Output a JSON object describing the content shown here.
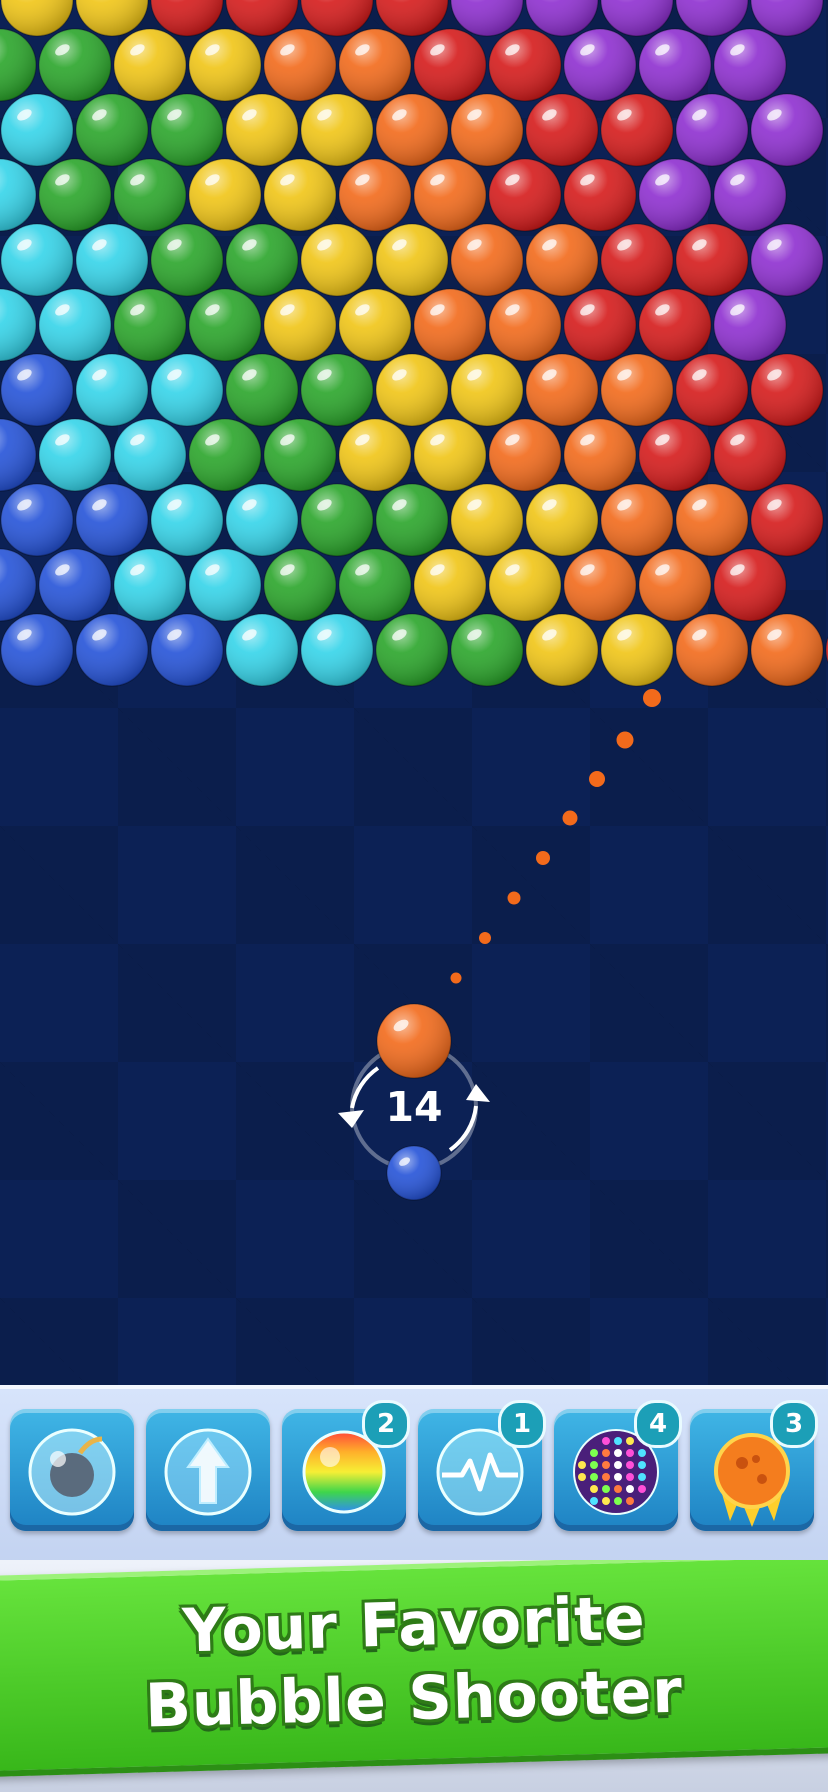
{
  "game": {
    "shots_left": "14",
    "current_bubble": "orange",
    "next_bubble": "blue"
  },
  "bubble_colors": {
    "green": "#2aa52a",
    "yellow": "#f0c516",
    "orange": "#f26a1b",
    "red": "#d51b1b",
    "purple": "#8e2fd0",
    "cyan": "#35d4e9",
    "blue": "#2553d8"
  },
  "bubble_grid": [
    [
      "yellow",
      "yellow",
      "red",
      "red",
      "red",
      "red",
      "purple",
      "purple",
      "purple",
      "purple",
      "purple"
    ],
    [
      "green",
      "green",
      "yellow",
      "yellow",
      "orange",
      "orange",
      "red",
      "red",
      "purple",
      "purple",
      "purple"
    ],
    [
      "cyan",
      "green",
      "green",
      "yellow",
      "yellow",
      "orange",
      "orange",
      "red",
      "red",
      "purple",
      "purple"
    ],
    [
      "cyan",
      "green",
      "green",
      "yellow",
      "yellow",
      "orange",
      "orange",
      "red",
      "red",
      "purple",
      "purple"
    ],
    [
      "cyan",
      "cyan",
      "green",
      "green",
      "yellow",
      "yellow",
      "orange",
      "orange",
      "red",
      "red",
      "purple"
    ],
    [
      "cyan",
      "cyan",
      "green",
      "green",
      "yellow",
      "yellow",
      "orange",
      "orange",
      "red",
      "red",
      "purple"
    ],
    [
      "blue",
      "cyan",
      "cyan",
      "green",
      "green",
      "yellow",
      "yellow",
      "orange",
      "orange",
      "red",
      "red"
    ],
    [
      "blue",
      "cyan",
      "cyan",
      "green",
      "green",
      "yellow",
      "yellow",
      "orange",
      "orange",
      "red",
      "red"
    ],
    [
      "blue",
      "blue",
      "cyan",
      "cyan",
      "green",
      "green",
      "yellow",
      "yellow",
      "orange",
      "orange",
      "red"
    ],
    [
      "blue",
      "blue",
      "cyan",
      "cyan",
      "green",
      "green",
      "yellow",
      "yellow",
      "orange",
      "orange",
      "red"
    ],
    [
      "blue",
      "blue",
      "blue",
      "cyan",
      "cyan",
      "green",
      "green",
      "yellow",
      "yellow",
      "orange",
      "orange",
      "red"
    ]
  ],
  "boosters": [
    {
      "name": "bomb",
      "icon": "bomb-bubble-icon",
      "count": ""
    },
    {
      "name": "arrow",
      "icon": "arrow-bubble-icon",
      "count": ""
    },
    {
      "name": "rainbow",
      "icon": "rainbow-ball-icon",
      "count": "2"
    },
    {
      "name": "lightning",
      "icon": "lightning-bubble-icon",
      "count": "1"
    },
    {
      "name": "disco",
      "icon": "disco-ball-icon",
      "count": "4"
    },
    {
      "name": "fireball",
      "icon": "fireball-icon",
      "count": "3"
    }
  ],
  "banner": {
    "line1": "Your Favorite",
    "line2": "Bubble Shooter"
  }
}
